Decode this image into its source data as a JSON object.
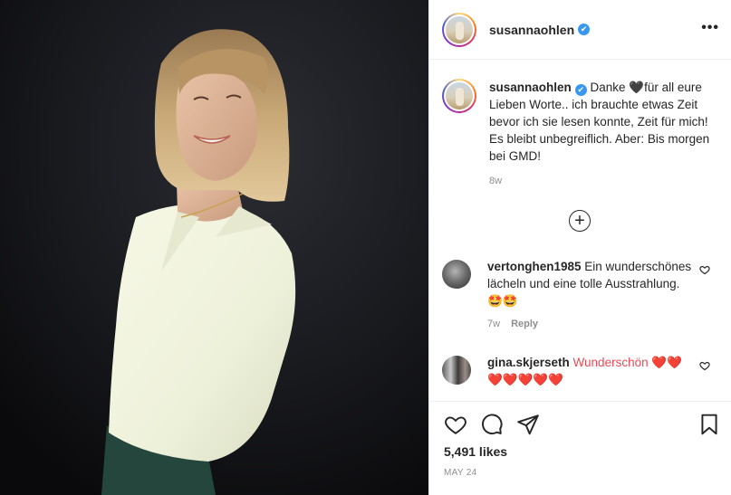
{
  "post": {
    "username": "susannaohlen",
    "verified_glyph": "✔",
    "more_glyph": "•••"
  },
  "caption": {
    "username": "susannaohlen",
    "text_before": " Danke ",
    "heart": "🖤",
    "text_after": "für all eure Lieben Worte.. ich brauchte etwas Zeit bevor ich sie lesen konnte, Zeit für mich! Es bleibt unbegreiflich. Aber: Bis morgen bei GMD!",
    "age": "8w"
  },
  "load_more_glyph": "+",
  "comments": [
    {
      "username": "vertonghen1985",
      "text": " Ein wunderschönes lächeln und eine tolle Ausstrahlung. 🤩🤩",
      "age": "7w",
      "reply": "Reply"
    },
    {
      "username": "gina.skjerseth",
      "text": " Wunderschön ❤️❤️❤️❤️❤️❤️❤️"
    }
  ],
  "actions": {
    "likes": "5,491 likes",
    "date": "MAY 24"
  },
  "icons": [
    "like-icon",
    "comment-icon",
    "share-icon",
    "save-icon",
    "more-options-icon",
    "verified-icon",
    "add-comment-icon",
    "comment-like-icon"
  ],
  "colors": {
    "verified_blue": "#3897f0",
    "heart_red": "#ed4956",
    "meta_gray": "#8e8e8e",
    "text": "#262626"
  }
}
